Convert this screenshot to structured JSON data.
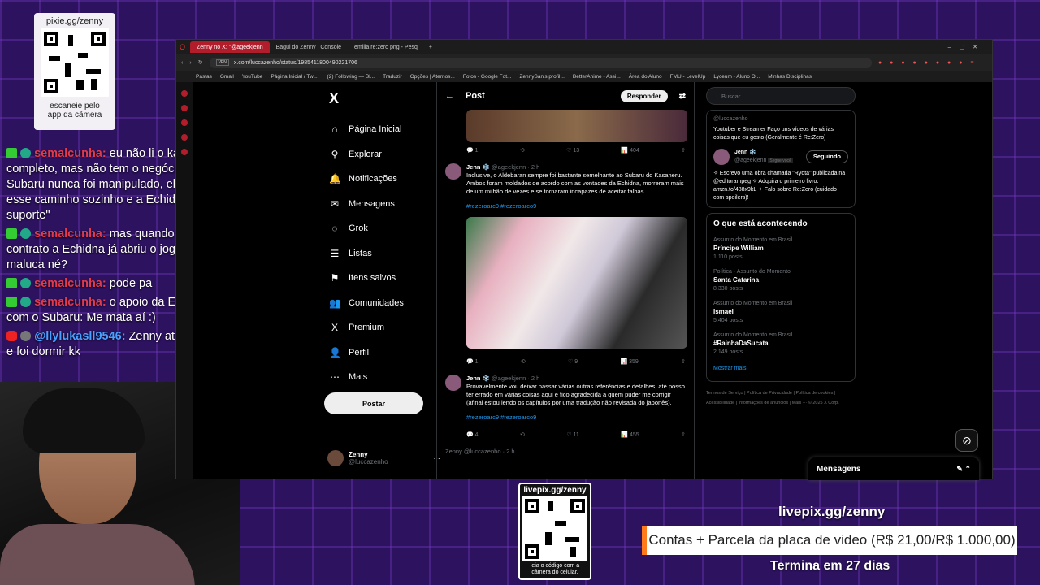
{
  "qr_top": {
    "url": "pixie.gg/zenny",
    "caption": "escaneie pelo app da câmera"
  },
  "chat": [
    {
      "user": "semalcunha:",
      "text": "eu não li o kasaneru completo, mas não tem o negócio que \"o Subaru nunca foi manipulado, ele foi por esse caminho sozinho e a Echidna só deu suporte\""
    },
    {
      "user": "semalcunha:",
      "text": "mas quando ele faz o contrato a Echidna já abriu o jogo que é maluca né?"
    },
    {
      "user": "semalcunha:",
      "text": "pode pa"
    },
    {
      "user": "semalcunha:",
      "text": "o apoio da Echidna com o Subaru: Me mata aí :)"
    },
    {
      "user": "@llylukasll9546:",
      "text": "Zenny ativou a live e foi dormir kk"
    }
  ],
  "browser": {
    "tabs": [
      "Zenny no X: \"@ageekjenn",
      "Bagui do Zenny | Console",
      "emilia re:zero png - Pesq"
    ],
    "url": "x.com/luccazenho/status/1985411800490221706",
    "vpn": "VPN",
    "bookmarks": [
      "Pastas",
      "Gmail",
      "YouTube",
      "Página Inicial / Twi...",
      "(2) Following — Bl...",
      "Traduzir",
      "Opções | Aternos...",
      "Fotos - Google Fot...",
      "ZennySan's profil...",
      "BetterAnime - Assi...",
      "Área do Aluno",
      "FMU - LevelUp",
      "Lyceum - Aluno O...",
      "Minhas Disciplinas"
    ]
  },
  "x": {
    "logo": "X",
    "nav": [
      {
        "icon": "⌂",
        "label": "Página Inicial"
      },
      {
        "icon": "⚲",
        "label": "Explorar"
      },
      {
        "icon": "🔔",
        "label": "Notificações"
      },
      {
        "icon": "✉",
        "label": "Mensagens"
      },
      {
        "icon": "◌",
        "label": "Grok"
      },
      {
        "icon": "☰",
        "label": "Listas"
      },
      {
        "icon": "⚑",
        "label": "Itens salvos"
      },
      {
        "icon": "👥",
        "label": "Comunidades"
      },
      {
        "icon": "X",
        "label": "Premium"
      },
      {
        "icon": "👤",
        "label": "Perfil"
      },
      {
        "icon": "⋯",
        "label": "Mais"
      }
    ],
    "post_button": "Postar",
    "me": {
      "name": "Zenny",
      "handle": "@luccazenho"
    },
    "feed_title": "Post",
    "reply_button": "Responder",
    "actions1": [
      "1",
      "13",
      "404"
    ],
    "tweet1": {
      "name": "Jenn ❄️",
      "meta": "@ageekjenn · 2 h",
      "text": "Inclusive, o Aldebaran sempre foi bastante semelhante ao Subaru do Kasaneru. Ambos foram moldados de acordo com as vontades da Echidna, morreram mais de um milhão de vezes e se tornaram incapazes de aceitar falhas.",
      "tags": "#rezeroarc9 #rezeroarco9",
      "actions": [
        "1",
        "9",
        "359"
      ]
    },
    "tweet2": {
      "name": "Jenn ❄️",
      "meta": "@ageekjenn · 2 h",
      "text": "Provavelmente vou deixar passar várias outras referências e detalhes, até posso ter errado em várias coisas aqui e fico agradecida a quem puder me corrigir (afinal estou lendo os capítulos por uma tradução não revisada do japonês).",
      "tags": "#rezeroarc9 #rezeroarco9",
      "actions": [
        "4",
        "11",
        "455"
      ]
    },
    "tweet3_peek": "Zenny @luccazenho · 2 h",
    "search_placeholder": "Buscar",
    "profile_card": {
      "handle": "@luccazenho",
      "bio": "Youtuber e Streamer Faço uns vídeos de várias coisas que eu gosto (Geralmente é Re:Zero)",
      "name2": "Jenn ❄️",
      "handle2": "@ageekjenn",
      "follows_you": "Segue você",
      "follow_button": "Seguindo",
      "bio2": "✧ Escrevo uma obra chamada \"Ryota\" publicada na @editorampeg ✧ Adquira o primeiro livro: amzn.to/488x9kL ✧ Falo sobre Re:Zero (cuidado com spoilers)!"
    },
    "trends_title": "O que está acontecendo",
    "trends": [
      {
        "ctx": "Assunto do Momento em Brasil",
        "name": "Príncipe William",
        "posts": "1.110 posts"
      },
      {
        "ctx": "Política · Assunto do Momento",
        "name": "Santa Catarina",
        "posts": "8.330 posts"
      },
      {
        "ctx": "Assunto do Momento em Brasil",
        "name": "Ismael",
        "posts": "5.404 posts"
      },
      {
        "ctx": "Assunto do Momento em Brasil",
        "name": "#RainhaDaSucata",
        "posts": "2.149 posts"
      }
    ],
    "show_more": "Mostrar mais",
    "footer": "Termos de Serviço | Política de Privacidade | Política de cookies | Acessibilidade | Informações de anúncios | Mais ··· © 2025 X Corp.",
    "messages": "Mensagens"
  },
  "qr_bottom": {
    "url": "livepix.gg/zenny",
    "caption": "leia o código com a câmera do celular."
  },
  "goal": {
    "url": "livepix.gg/zenny",
    "bar": "Contas + Parcela da placa de video (R$ 21,00/R$ 1.000,00)",
    "ends": "Termina em 27 dias"
  }
}
